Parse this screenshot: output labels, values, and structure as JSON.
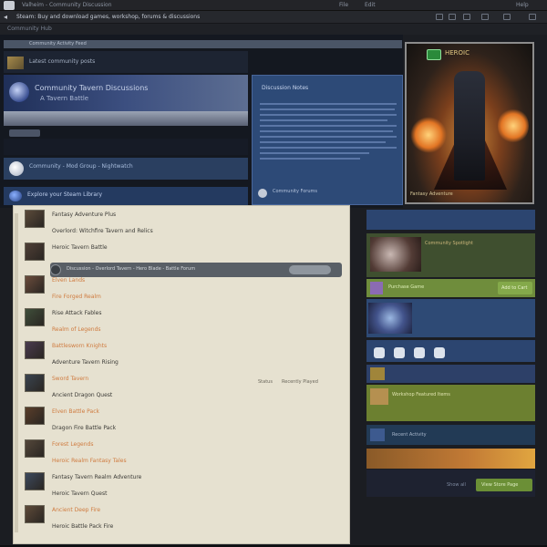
{
  "titlebar": {
    "title": "Valheim - Community Discussion",
    "menu": [
      "File",
      "Edit",
      "Help"
    ]
  },
  "address": {
    "url": "Steam: Buy and download games, workshop, forums & discussions"
  },
  "subbar": {
    "crumb": "Community Hub"
  },
  "left": {
    "header_strip": "Community Activity Feed",
    "row_a": "Latest community posts",
    "banner_title": "Community Tavern Discussions",
    "banner_sub": "A Tavern Battle",
    "row_b": "Community - Mod Group - Nightwatch",
    "row_c": "Explore your Steam Library"
  },
  "doc": {
    "title": "Discussion Notes",
    "footer": "Community Forums"
  },
  "hero": {
    "title": "HEROIC",
    "tag": "Fantasy Adventure"
  },
  "list": {
    "items": [
      {
        "text": "Fantasy Adventure Plus",
        "orange": false
      },
      {
        "text": "Overlord: Witchfire Tavern and Relics",
        "orange": false
      },
      {
        "text": "Heroic Tavern Battle",
        "orange": false
      },
      {
        "text": "Mod pack",
        "orange": false
      },
      {
        "text": "Elven Lands",
        "orange": true
      },
      {
        "text": "Fire Forged Realm",
        "orange": true
      },
      {
        "text": "Rise Attack Fables",
        "orange": false
      },
      {
        "text": "Realm of Legends",
        "orange": true
      },
      {
        "text": "Battlesworn Knights",
        "orange": true
      },
      {
        "text": "Adventure Tavern Rising",
        "orange": false
      },
      {
        "text": "Sword Tavern",
        "orange": true
      },
      {
        "text": "Ancient Dragon Quest",
        "orange": false
      },
      {
        "text": "Elven Battle Pack",
        "orange": true
      },
      {
        "text": "Dragon Fire Battle Pack",
        "orange": false
      },
      {
        "text": "Forest Legends",
        "orange": true
      },
      {
        "text": "Heroic Realm Fantasy Tales",
        "orange": true
      },
      {
        "text": "Fantasy Tavern Realm Adventure",
        "orange": false
      },
      {
        "text": "Heroic Tavern Quest",
        "orange": false
      },
      {
        "text": "Ancient Deep Fire",
        "orange": true
      },
      {
        "text": "Heroic Battle Pack Fire",
        "orange": false
      }
    ],
    "selected_row": "Discussion - Overlord Tavern - Hero Blade - Battle Forum",
    "right_text_a": "Status",
    "right_text_b": "Recently Played"
  },
  "right": {
    "card_b_title": "Community Spotlight",
    "card_c_title": "Purchase Game",
    "card_c_button": "Add to Cart",
    "card_g_title": "Workshop Featured Items",
    "card_h_title": "Recent Activity",
    "card_j_label": "Show all",
    "card_j_button": "View Store Page"
  },
  "colors": {
    "accent_green": "#84a94a",
    "accent_blue": "#2c4570",
    "panel_cream": "#e6e1d0",
    "orange_text": "#cf7a3e"
  }
}
